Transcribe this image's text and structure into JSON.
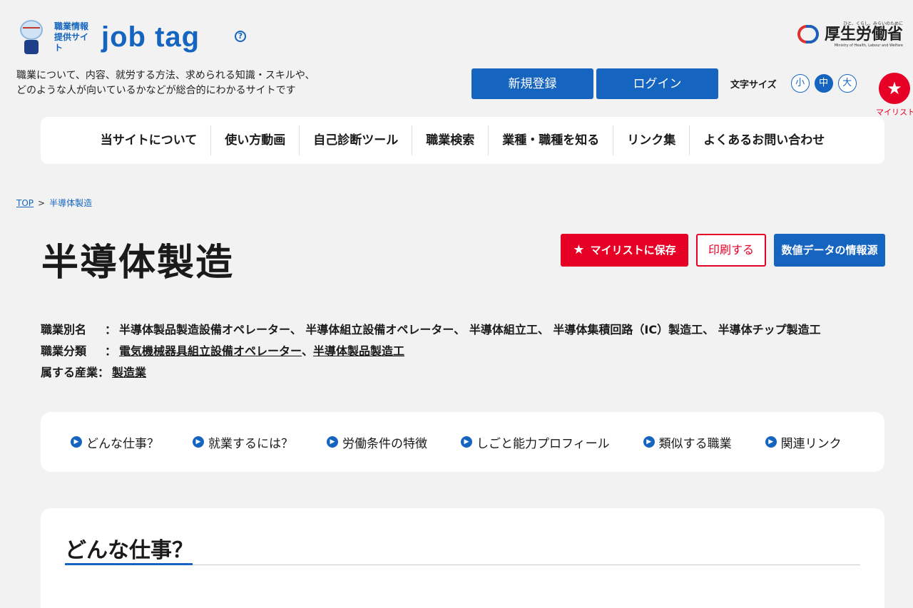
{
  "header": {
    "site_label": "職業情報提供サイト",
    "brand": "job tag",
    "help_icon": "question-circle-icon",
    "ministry_tagline": "ひと、くらし、みらいのために",
    "ministry_name": "厚生労働省",
    "ministry_en": "Ministry of Health, Labour and Welfare",
    "tagline_line1": "職業について、内容、就労する方法、求められる知識・スキルや、",
    "tagline_line2": "どのような人が向いているかなどが総合的にわかるサイトです",
    "register_label": "新規登録",
    "login_label": "ログイン",
    "font_size_label": "文字サイズ",
    "font_sizes": [
      "小",
      "中",
      "大"
    ],
    "font_size_selected": "中",
    "mylist_label": "マイリスト"
  },
  "nav": {
    "items": [
      "当サイトについて",
      "使い方動画",
      "自己診断ツール",
      "職業検索",
      "業種・職種を知る",
      "リンク集",
      "よくあるお問い合わせ"
    ]
  },
  "breadcrumb": {
    "top": "TOP",
    "separator": ">",
    "current": "半導体製造"
  },
  "page": {
    "title": "半導体製造",
    "save_label": "マイリストに保存",
    "print_label": "印刷する",
    "source_label": "数値データの情報源"
  },
  "meta": {
    "alias_key": "職業別名",
    "alias_value": "半導体製品製造設備オペレーター、 半導体組立設備オペレーター、 半導体組立工、 半導体集積回路（IC）製造工、 半導体チップ製造工",
    "category_key": "職業分類",
    "category_link1": "電気機械器具組立設備オペレーター",
    "category_comma": "、",
    "category_link2": "半導体製品製造工",
    "industry_key": "属する産業",
    "industry_link": "製造業",
    "separator": "："
  },
  "anchors": [
    "どんな仕事？",
    "就業するには？",
    "労働条件の特徴",
    "しごと能力プロフィール",
    "類似する職業",
    "関連リンク"
  ],
  "section": {
    "title": "どんな仕事？"
  },
  "colors": {
    "brand_blue": "#1565c0",
    "accent_red": "#e60026",
    "background": "#f2f2f2"
  }
}
